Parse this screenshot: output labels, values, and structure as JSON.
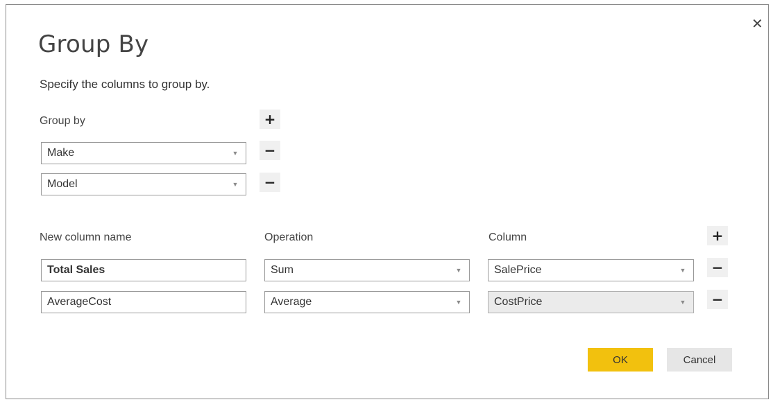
{
  "dialog": {
    "title": "Group By",
    "close_icon": "close-icon",
    "subtitle": "Specify the columns to group by."
  },
  "group_by": {
    "label": "Group by",
    "add_icon": "plus-icon",
    "remove_icon": "minus-icon",
    "rows": [
      {
        "value": "Make"
      },
      {
        "value": "Model"
      }
    ]
  },
  "aggregations": {
    "headers": {
      "new_column_name": "New column name",
      "operation": "Operation",
      "column": "Column"
    },
    "rows": [
      {
        "name": "Total Sales",
        "operation": "Sum",
        "column": "SalePrice"
      },
      {
        "name": "AverageCost",
        "operation": "Average",
        "column": "CostPrice"
      }
    ]
  },
  "footer": {
    "ok_label": "OK",
    "cancel_label": "Cancel"
  },
  "colors": {
    "ok_button": "#f2c10e",
    "cancel_button": "#e6e6e6",
    "icon_button": "#f0f0f0"
  }
}
